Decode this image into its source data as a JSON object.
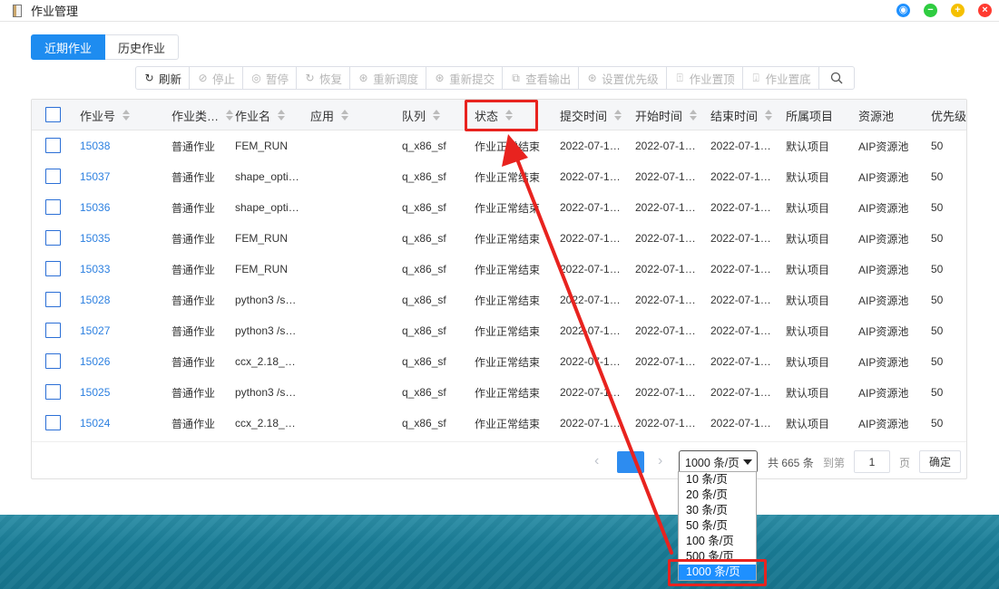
{
  "window": {
    "title": "作业管理",
    "buttons": [
      {
        "name": "target-icon",
        "color": "#1e90ff",
        "glyph": "◉"
      },
      {
        "name": "minimize-icon",
        "color": "#2ecc40",
        "glyph": "−"
      },
      {
        "name": "maximize-icon",
        "color": "#f5c000",
        "glyph": "+"
      },
      {
        "name": "close-icon",
        "color": "#ff3b30",
        "glyph": "×"
      }
    ]
  },
  "tabs": [
    {
      "label": "近期作业",
      "active": true
    },
    {
      "label": "历史作业",
      "active": false
    }
  ],
  "toolbar": {
    "buttons": [
      {
        "label": "刷新",
        "icon": "refresh-icon",
        "glyph": "↻",
        "enabled": true
      },
      {
        "label": "停止",
        "icon": "stop-icon",
        "glyph": "⊘",
        "enabled": false
      },
      {
        "label": "暂停",
        "icon": "pause-icon",
        "glyph": "◎",
        "enabled": false
      },
      {
        "label": "恢复",
        "icon": "resume-icon",
        "glyph": "↻",
        "enabled": false
      },
      {
        "label": "重新调度",
        "icon": "reschedule-icon",
        "glyph": "⊛",
        "enabled": false
      },
      {
        "label": "重新提交",
        "icon": "resubmit-icon",
        "glyph": "⊛",
        "enabled": false
      },
      {
        "label": "查看输出",
        "icon": "view-output-icon",
        "glyph": "⧉",
        "enabled": false
      },
      {
        "label": "设置优先级",
        "icon": "priority-icon",
        "glyph": "⊛",
        "enabled": false
      },
      {
        "label": "作业置顶",
        "icon": "pin-top-icon",
        "glyph": "⍐",
        "enabled": false
      },
      {
        "label": "作业置底",
        "icon": "pin-bottom-icon",
        "glyph": "⍗",
        "enabled": false
      }
    ]
  },
  "table": {
    "columns": [
      "作业号",
      "作业类…",
      "作业名",
      "应用",
      "队列",
      "状态",
      "提交时间",
      "开始时间",
      "结束时间",
      "所属项目",
      "资源池",
      "优先级"
    ],
    "rows": [
      {
        "id": "15038",
        "type": "普通作业",
        "name": "FEM_RUN",
        "app": "",
        "queue": "q_x86_sf",
        "status": "作业正常结束",
        "submit": "2022-07-1…",
        "start": "2022-07-1…",
        "end": "2022-07-1…",
        "project": "默认项目",
        "pool": "AIP资源池",
        "priority": "50"
      },
      {
        "id": "15037",
        "type": "普通作业",
        "name": "shape_opti…",
        "app": "",
        "queue": "q_x86_sf",
        "status": "作业正常结束",
        "submit": "2022-07-1…",
        "start": "2022-07-1…",
        "end": "2022-07-1…",
        "project": "默认项目",
        "pool": "AIP资源池",
        "priority": "50"
      },
      {
        "id": "15036",
        "type": "普通作业",
        "name": "shape_opti…",
        "app": "",
        "queue": "q_x86_sf",
        "status": "作业正常结束",
        "submit": "2022-07-1…",
        "start": "2022-07-1…",
        "end": "2022-07-1…",
        "project": "默认项目",
        "pool": "AIP资源池",
        "priority": "50"
      },
      {
        "id": "15035",
        "type": "普通作业",
        "name": "FEM_RUN",
        "app": "",
        "queue": "q_x86_sf",
        "status": "作业正常结束",
        "submit": "2022-07-1…",
        "start": "2022-07-1…",
        "end": "2022-07-1…",
        "project": "默认项目",
        "pool": "AIP资源池",
        "priority": "50"
      },
      {
        "id": "15033",
        "type": "普通作业",
        "name": "FEM_RUN",
        "app": "",
        "queue": "q_x86_sf",
        "status": "作业正常结束",
        "submit": "2022-07-1…",
        "start": "2022-07-1…",
        "end": "2022-07-1…",
        "project": "默认项目",
        "pool": "AIP资源池",
        "priority": "50"
      },
      {
        "id": "15028",
        "type": "普通作业",
        "name": "python3 /s…",
        "app": "",
        "queue": "q_x86_sf",
        "status": "作业正常结束",
        "submit": "2022-07-1…",
        "start": "2022-07-1…",
        "end": "2022-07-1…",
        "project": "默认项目",
        "pool": "AIP资源池",
        "priority": "50"
      },
      {
        "id": "15027",
        "type": "普通作业",
        "name": "python3 /s…",
        "app": "",
        "queue": "q_x86_sf",
        "status": "作业正常结束",
        "submit": "2022-07-1…",
        "start": "2022-07-1…",
        "end": "2022-07-1…",
        "project": "默认项目",
        "pool": "AIP资源池",
        "priority": "50"
      },
      {
        "id": "15026",
        "type": "普通作业",
        "name": "ccx_2.18_…",
        "app": "",
        "queue": "q_x86_sf",
        "status": "作业正常结束",
        "submit": "2022-07-1…",
        "start": "2022-07-1…",
        "end": "2022-07-1…",
        "project": "默认项目",
        "pool": "AIP资源池",
        "priority": "50"
      },
      {
        "id": "15025",
        "type": "普通作业",
        "name": "python3 /s…",
        "app": "",
        "queue": "q_x86_sf",
        "status": "作业正常结束",
        "submit": "2022-07-1…",
        "start": "2022-07-1…",
        "end": "2022-07-1…",
        "project": "默认项目",
        "pool": "AIP资源池",
        "priority": "50"
      },
      {
        "id": "15024",
        "type": "普通作业",
        "name": "ccx_2.18_…",
        "app": "",
        "queue": "q_x86_sf",
        "status": "作业正常结束",
        "submit": "2022-07-1…",
        "start": "2022-07-1…",
        "end": "2022-07-1…",
        "project": "默认项目",
        "pool": "AIP资源池",
        "priority": "50"
      }
    ]
  },
  "pager": {
    "prev": "‹",
    "next": "›",
    "page_size": "1000 条/页",
    "total": "共 665 条",
    "goto_label": "到第",
    "goto_value": "1",
    "page_unit": "页",
    "confirm": "确定",
    "options": [
      "10 条/页",
      "20 条/页",
      "30 条/页",
      "50 条/页",
      "100 条/页",
      "500 条/页",
      "1000 条/页"
    ],
    "selected_option": "1000 条/页"
  },
  "colors": {
    "accent": "#1e8cf0",
    "link": "#2d80e0",
    "highlight": "#e8231f"
  }
}
